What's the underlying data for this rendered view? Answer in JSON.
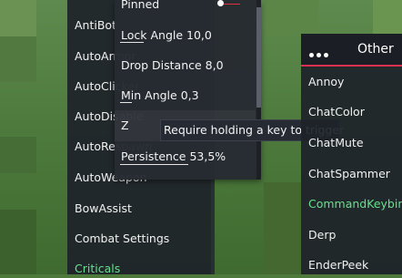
{
  "modules_list": {
    "items": [
      {
        "label": "AntiBot",
        "color": "#f2f2f2"
      },
      {
        "label": "AutoArmor",
        "color": "#f2f2f2"
      },
      {
        "label": "AutoClicker",
        "color": "#f2f2f2"
      },
      {
        "label": "AutoDisable",
        "color": "#f2f2f2"
      },
      {
        "label": "AutoRespawn",
        "color": "#f2f2f2"
      },
      {
        "label": "AutoWeapon",
        "color": "#f2f2f2"
      },
      {
        "label": "BowAssist",
        "color": "#f2f2f2"
      },
      {
        "label": "Combat Settings",
        "color": "#f2f2f2"
      },
      {
        "label": "Criticals",
        "color": "#66e08a"
      }
    ]
  },
  "settings_popup": {
    "pinned_label": "Pinned",
    "lock_angle": "Lock Angle 10,0",
    "drop_distance": "Drop Distance 8,0",
    "min_angle": "Min Angle 0,3",
    "keybind": "Z",
    "persistence": "Persistence 53,5%",
    "persistence_value": 0.535
  },
  "tooltip": {
    "text": "Require holding a key to trigger"
  },
  "other_panel": {
    "title": "Other",
    "accent_color": "#e03050",
    "items": [
      {
        "label": "Annoy"
      },
      {
        "label": "ChatColor"
      },
      {
        "label": "ChatMute"
      },
      {
        "label": "ChatSpammer"
      },
      {
        "label": "CommandKeybinds",
        "active": true
      },
      {
        "label": "Derp"
      },
      {
        "label": "EnderPeek"
      }
    ]
  }
}
